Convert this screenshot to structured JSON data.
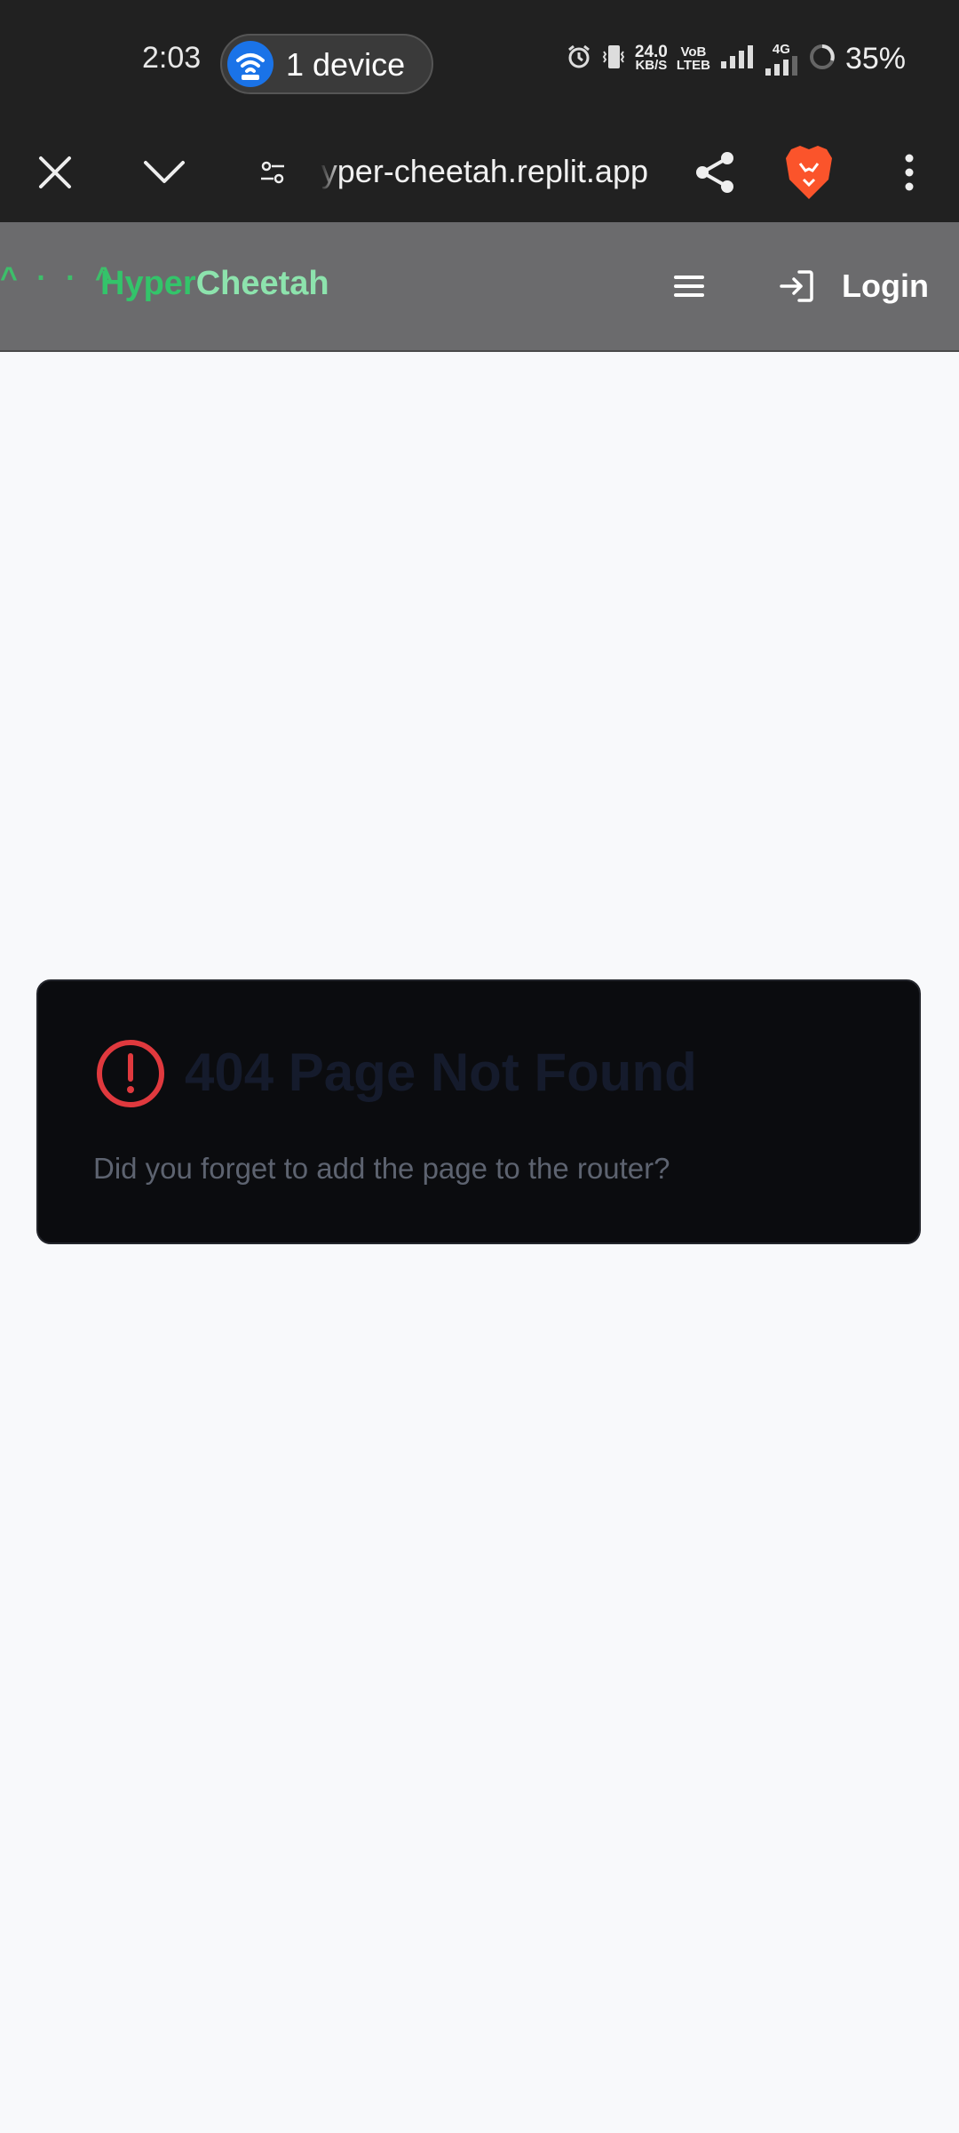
{
  "status_bar": {
    "time": "2:03",
    "hotspot_label": "1 device",
    "network_speed_value": "24.0",
    "network_speed_unit": "KB/S",
    "volte_top": "VoB",
    "volte_bottom": "LTEB",
    "mobile_data": "4G",
    "battery": "35%"
  },
  "browser": {
    "url": "hyper-cheetah.replit.app",
    "brand_color": "#fb542b"
  },
  "app": {
    "logo_face": "^ · · ^",
    "logo_part1": "Hyper",
    "logo_part2": "Cheetah",
    "login_label": "Login",
    "accent_color": "#33c46a"
  },
  "error": {
    "title": "404 Page Not Found",
    "description": "Did you forget to add the page to the router?",
    "icon": "alert-circle-icon",
    "icon_color": "#e0393e"
  }
}
